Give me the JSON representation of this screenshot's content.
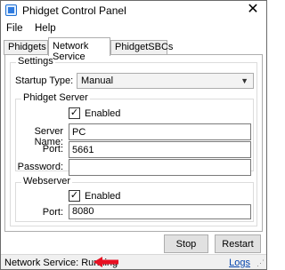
{
  "window": {
    "title": "Phidget Control Panel",
    "close_glyph": "✕"
  },
  "menu": {
    "items": [
      {
        "label": "File"
      },
      {
        "label": "Help"
      }
    ]
  },
  "tabs": [
    {
      "label": "Phidgets",
      "active": false
    },
    {
      "label": "Network Service",
      "active": true
    },
    {
      "label": "PhidgetSBCs",
      "active": false
    }
  ],
  "settings": {
    "group_title": "Settings",
    "startup_type_label": "Startup Type:",
    "startup_type_value": "Manual"
  },
  "phidget_server": {
    "group_title": "Phidget Server",
    "enabled_label": "Enabled",
    "enabled_checked": true,
    "server_name_label": "Server Name:",
    "server_name_value": "PC",
    "port_label": "Port:",
    "port_value": "5661",
    "password_label": "Password:",
    "password_value": ""
  },
  "webserver": {
    "group_title": "Webserver",
    "enabled_label": "Enabled",
    "enabled_checked": true,
    "port_label": "Port:",
    "port_value": "8080"
  },
  "buttons": {
    "stop_label": "Stop",
    "restart_label": "Restart"
  },
  "status": {
    "text": "Network Service: Running",
    "logs_label": "Logs",
    "arrow_icon": "arrow-left-icon",
    "arrow_color": "#e81123"
  },
  "colors": {
    "accent": "#2f7be0",
    "link": "#0645ad"
  }
}
